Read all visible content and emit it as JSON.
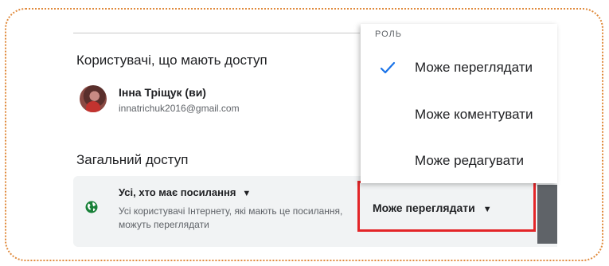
{
  "share_dialog": {
    "people_section_title": "Користувачі, що мають доступ",
    "user": {
      "name": "Інна Тріщук (ви)",
      "email": "innatrichuk2016@gmail.com"
    },
    "general_access_title": "Загальний доступ",
    "access": {
      "type_label": "Усі, хто має посилання",
      "caret": "▼",
      "description": "Усі користувачі Інтернету, які мають це посилання, можуть переглядати",
      "icon": "globe-icon",
      "role_button_label": "Може переглядати",
      "role_caret": "▼"
    }
  },
  "role_menu": {
    "header": "РОЛЬ",
    "items": [
      {
        "label": "Може переглядати",
        "selected": true
      },
      {
        "label": "Може коментувати",
        "selected": false
      },
      {
        "label": "Може редагувати",
        "selected": false
      }
    ]
  },
  "colors": {
    "highlight_border": "#e32528",
    "check": "#1a73e8",
    "globe": "#188038",
    "frame_dots": "#e08a3c"
  }
}
